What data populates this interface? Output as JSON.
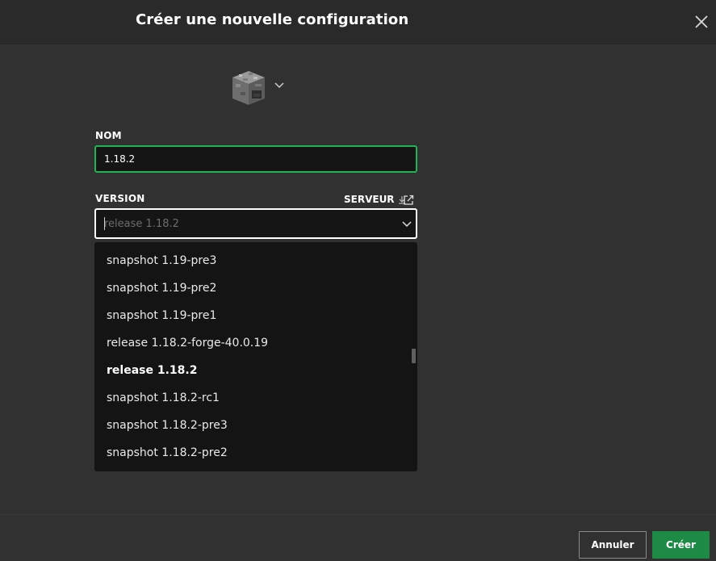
{
  "dialog": {
    "title": "Créer une nouvelle configuration",
    "close_icon": "close-icon"
  },
  "icon_picker": {
    "icon": "furnace-block-icon",
    "chevron": "chevron-down-icon"
  },
  "name_field": {
    "label": "NOM",
    "value": "1.18.2",
    "focus_color": "#1fb455"
  },
  "version_field": {
    "label": "VERSION",
    "placeholder": "release 1.18.2",
    "server_link_label": "SERVEUR",
    "server_icon": "download-icon",
    "external_icon": "external-link-icon"
  },
  "version_options": [
    {
      "label": "snapshot 1.19-pre3",
      "selected": false
    },
    {
      "label": "snapshot 1.19-pre2",
      "selected": false
    },
    {
      "label": "snapshot 1.19-pre1",
      "selected": false
    },
    {
      "label": "release 1.18.2-forge-40.0.19",
      "selected": false
    },
    {
      "label": "release 1.18.2",
      "selected": true
    },
    {
      "label": "snapshot 1.18.2-rc1",
      "selected": false
    },
    {
      "label": "snapshot 1.18.2-pre3",
      "selected": false
    },
    {
      "label": "snapshot 1.18.2-pre2",
      "selected": false
    }
  ],
  "footer": {
    "cancel_label": "Annuler",
    "create_label": "Créer",
    "create_color": "#1d8a46"
  }
}
